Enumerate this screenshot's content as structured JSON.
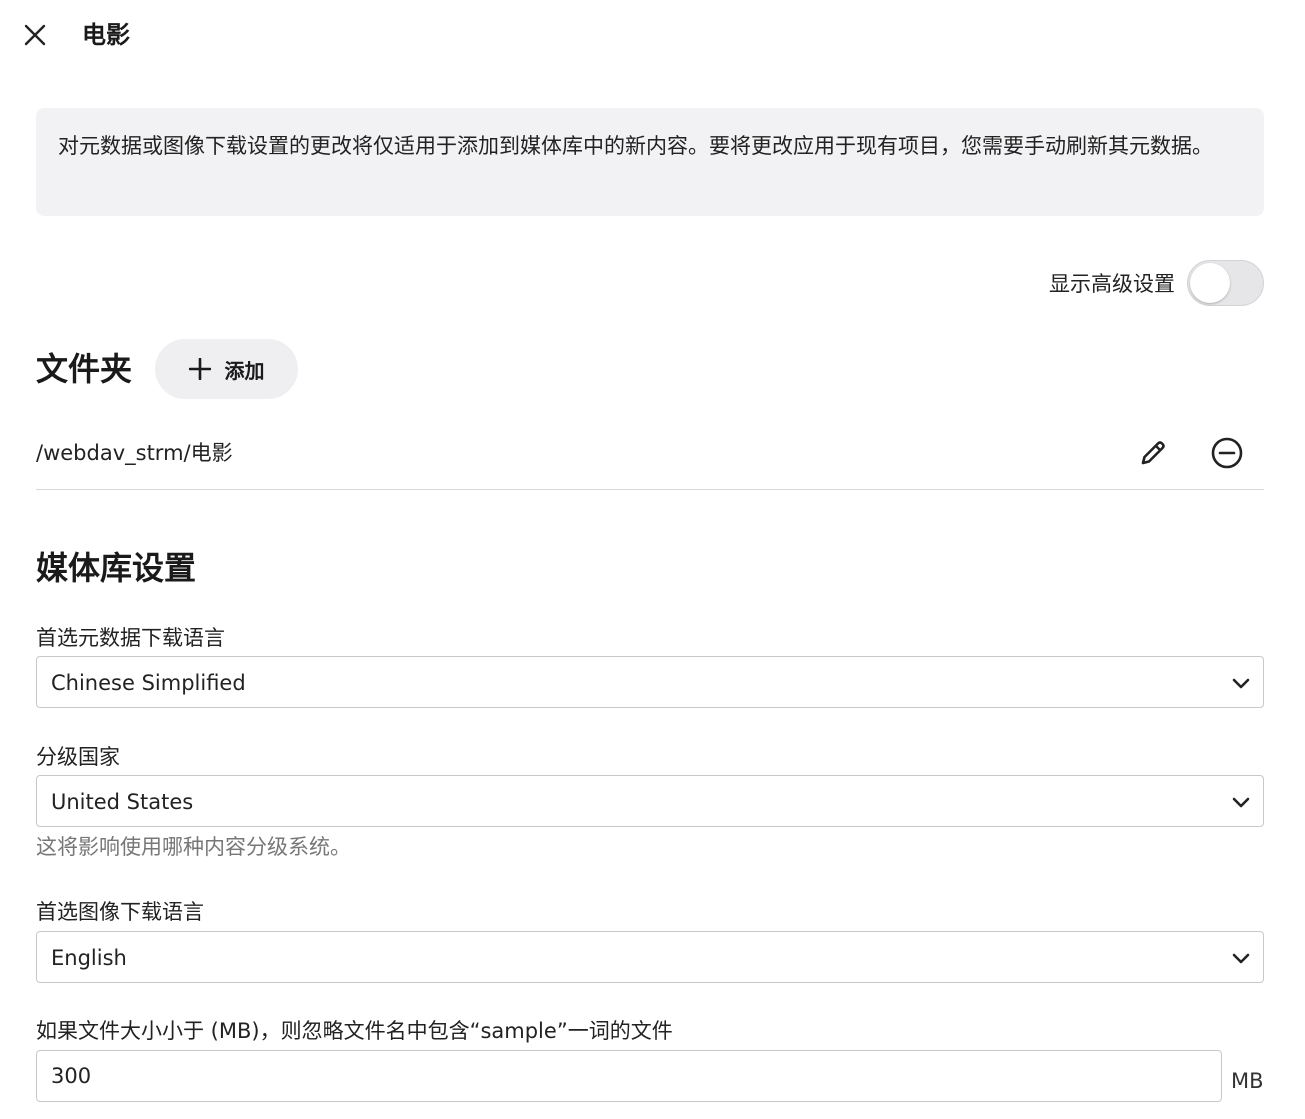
{
  "header": {
    "title": "电影"
  },
  "notice": {
    "text": "对元数据或图像下载设置的更改将仅适用于添加到媒体库中的新内容。要将更改应用于现有项目，您需要手动刷新其元数据。"
  },
  "advanced": {
    "label": "显示高级设置",
    "enabled": false
  },
  "folders": {
    "title": "文件夹",
    "add_label": "添加",
    "items": [
      {
        "path": "/webdav_strm/电影"
      }
    ]
  },
  "library_settings": {
    "title": "媒体库设置",
    "metadata_language": {
      "label": "首选元数据下载语言",
      "value": "Chinese Simplified"
    },
    "country": {
      "label": "分级国家",
      "value": "United States",
      "help": "这将影响使用哪种内容分级系统。"
    },
    "image_language": {
      "label": "首选图像下载语言",
      "value": "English"
    },
    "sample_size": {
      "label": "如果文件大小小于 (MB)，则忽略文件名中包含“sample”一词的文件",
      "value": "300",
      "unit": "MB"
    }
  },
  "icons": {
    "close": "close-icon",
    "add": "plus-icon",
    "edit": "pencil-icon",
    "remove": "minus-circle-icon",
    "chevron": "chevron-down-icon"
  }
}
